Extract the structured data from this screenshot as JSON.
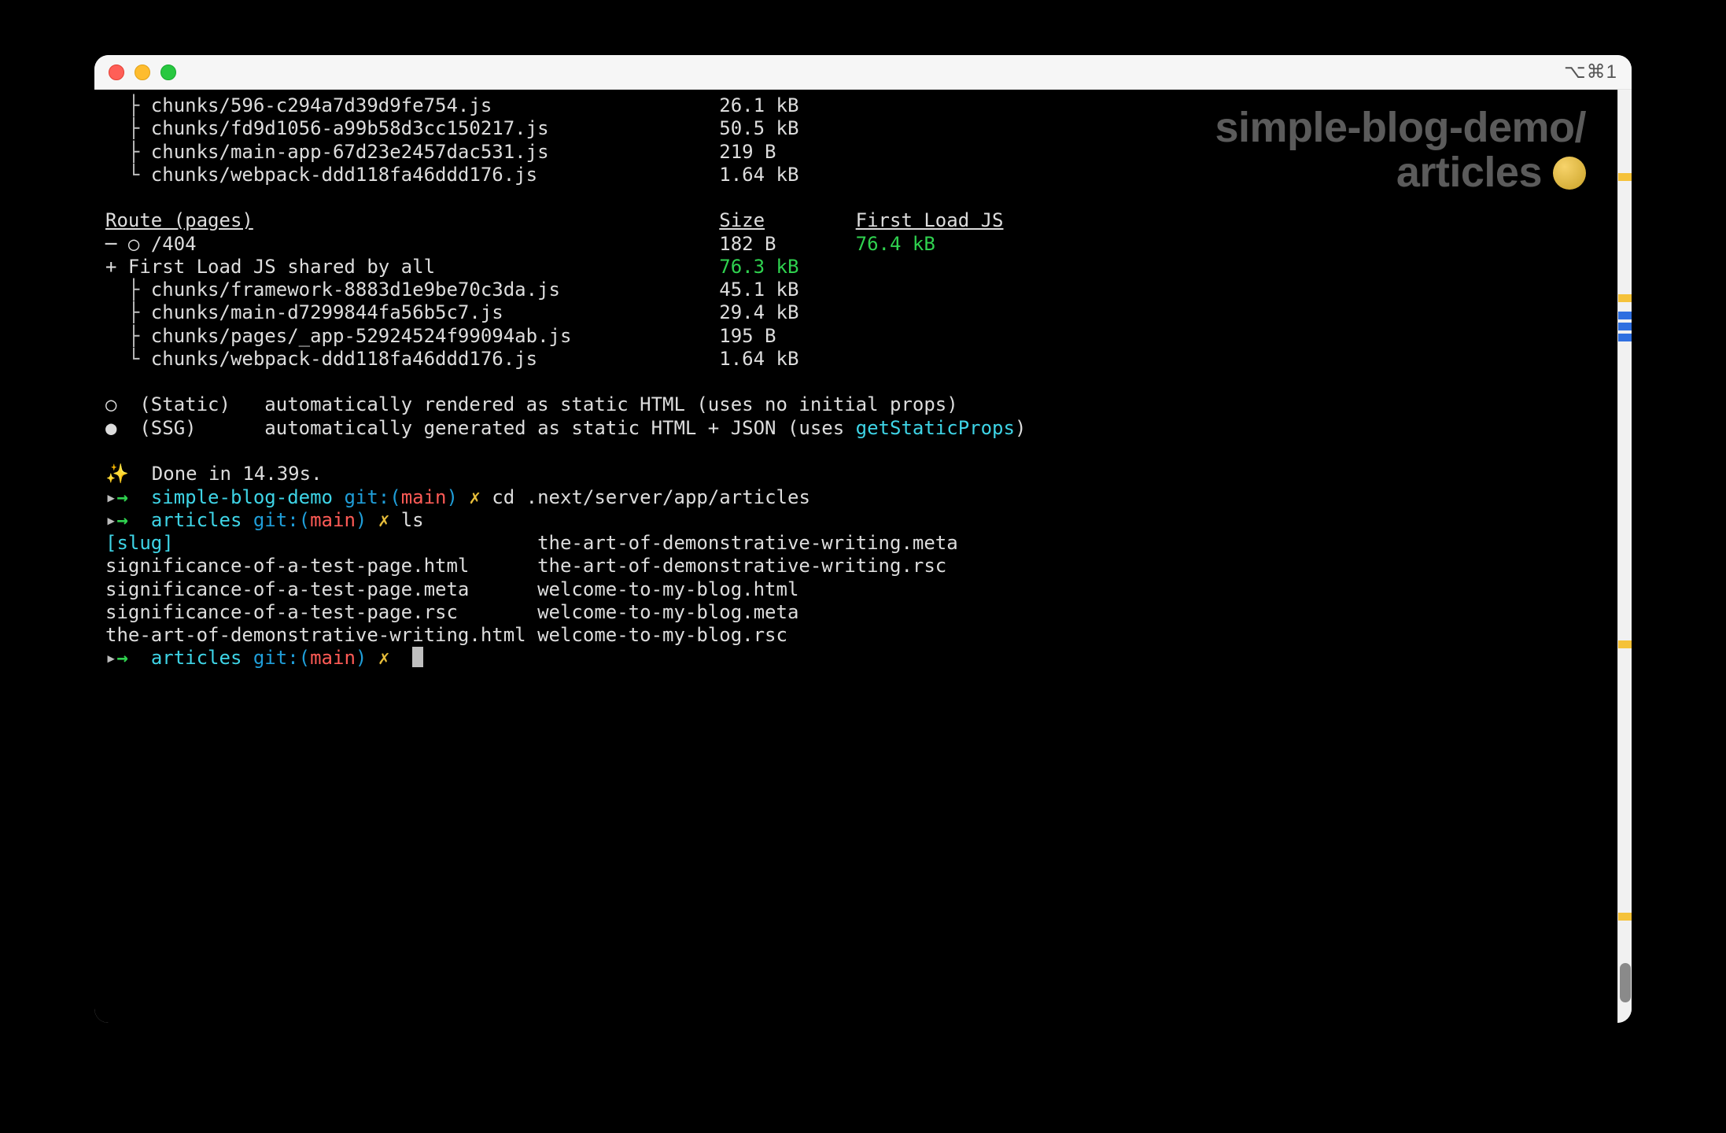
{
  "titlebar": {
    "right": "⌥⌘1"
  },
  "badge": {
    "line1": "simple-blog-demo/",
    "line2": "articles"
  },
  "chunks_top": [
    {
      "tree": "  ├ ",
      "name": "chunks/596-c294a7d39d9fe754.js",
      "size": "26.1 kB"
    },
    {
      "tree": "  ├ ",
      "name": "chunks/fd9d1056-a99b58d3cc150217.js",
      "size": "50.5 kB"
    },
    {
      "tree": "  ├ ",
      "name": "chunks/main-app-67d23e2457dac531.js",
      "size": "219 B"
    },
    {
      "tree": "  └ ",
      "name": "chunks/webpack-ddd118fa46ddd176.js",
      "size": "1.64 kB"
    }
  ],
  "pages_header": {
    "route": "Route (pages)",
    "size": "Size",
    "first": "First Load JS"
  },
  "route404": {
    "symbol": "─ ○ ",
    "path": "/404",
    "size": "182 B",
    "first": "76.4 kB"
  },
  "shared": {
    "prefix": "+ ",
    "label": "First Load JS shared by all",
    "size": "76.3 kB"
  },
  "chunks_shared": [
    {
      "tree": "  ├ ",
      "name": "chunks/framework-8883d1e9be70c3da.js",
      "size": "45.1 kB"
    },
    {
      "tree": "  ├ ",
      "name": "chunks/main-d7299844fa56b5c7.js",
      "size": "29.4 kB"
    },
    {
      "tree": "  ├ ",
      "name": "chunks/pages/_app-52924524f99094ab.js",
      "size": "195 B"
    },
    {
      "tree": "  └ ",
      "name": "chunks/webpack-ddd118fa46ddd176.js",
      "size": "1.64 kB"
    }
  ],
  "legend": {
    "static": {
      "sym": "○",
      "name": "(Static)",
      "desc": "automatically rendered as static HTML (uses no initial props)"
    },
    "ssg": {
      "sym": "●",
      "name": "(SSG)",
      "desc": "automatically generated as static HTML + JSON (uses ",
      "fn": "getStaticProps",
      "close": ")"
    }
  },
  "done": {
    "spark": "✨",
    "text": "  Done in 14.39s."
  },
  "prompt1": {
    "arrow": "→",
    "cwd": "simple-blog-demo",
    "git": "git:(",
    "branch": "main",
    "gitend": ")",
    "dirty": "✗",
    "cmd": "cd .next/server/app/articles"
  },
  "prompt2": {
    "arrow": "→",
    "cwd": "articles",
    "git": "git:(",
    "branch": "main",
    "gitend": ")",
    "dirty": "✗",
    "cmd": "ls"
  },
  "ls": {
    "cols": [
      [
        "[slug]",
        "significance-of-a-test-page.html",
        "significance-of-a-test-page.meta",
        "significance-of-a-test-page.rsc",
        "the-art-of-demonstrative-writing.html"
      ],
      [
        "the-art-of-demonstrative-writing.meta",
        "the-art-of-demonstrative-writing.rsc",
        "welcome-to-my-blog.html",
        "welcome-to-my-blog.meta",
        "welcome-to-my-blog.rsc"
      ]
    ]
  },
  "prompt3": {
    "arrow": "→",
    "cwd": "articles",
    "git": "git:(",
    "branch": "main",
    "gitend": ")",
    "dirty": "✗"
  },
  "col_pos": {
    "name": 8,
    "size": 54,
    "first": 66
  }
}
